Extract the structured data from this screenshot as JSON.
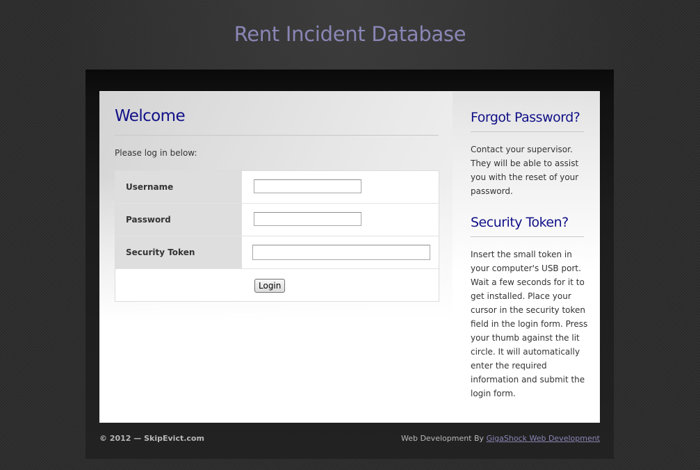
{
  "header": {
    "title": "Rent Incident Database"
  },
  "login": {
    "heading": "Welcome",
    "intro": "Please log in below:",
    "fields": {
      "username_label": "Username",
      "username_value": "",
      "password_label": "Password",
      "password_value": "",
      "token_label": "Security Token",
      "token_value": ""
    },
    "submit_label": "Login"
  },
  "sidebar": {
    "forgot_heading": "Forgot Password?",
    "forgot_text": "Contact your supervisor. They will be able to assist you with the reset of your password.",
    "token_heading": "Security Token?",
    "token_text": "Insert the small token in your computer's USB port. Wait a few seconds for it to get installed. Place your cursor in the security token field in the login form. Press your thumb against the lit circle.  It will automatically enter the required information and submit the login form."
  },
  "footer": {
    "copyright": "© 2012 — SkipEvict.com",
    "credit_prefix": "Web Development By ",
    "credit_link": "GigaShock Web Development"
  },
  "colors": {
    "title": "#8a86b6",
    "heading": "#101088",
    "link": "#8a86b6"
  }
}
